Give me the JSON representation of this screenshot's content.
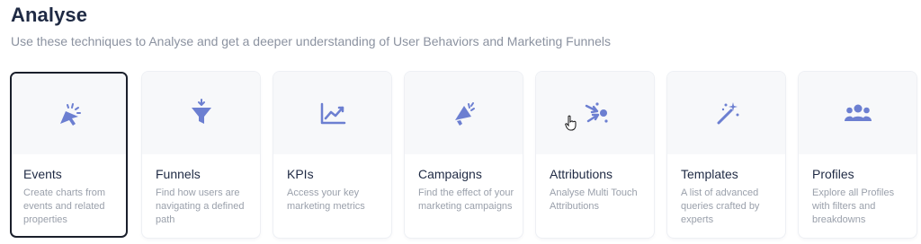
{
  "page": {
    "title": "Analyse",
    "subtitle": "Use these techniques to Analyse and get a deeper understanding of User Behaviors and Marketing Funnels"
  },
  "colors": {
    "icon": "#6c7fd1",
    "title": "#1f2a44",
    "muted": "#9aa0ab",
    "selected_border": "#1a1f2b"
  },
  "cards": [
    {
      "name": "Events",
      "description": "Create charts from events and related properties",
      "icon": "cursor-click-icon",
      "selected": true
    },
    {
      "name": "Funnels",
      "description": "Find how users are navigating a defined path",
      "icon": "funnel-icon",
      "selected": false
    },
    {
      "name": "KPIs",
      "description": "Access your key marketing metrics",
      "icon": "line-chart-icon",
      "selected": false
    },
    {
      "name": "Campaigns",
      "description": "Find the effect of your marketing campaigns",
      "icon": "megaphone-icon",
      "selected": false
    },
    {
      "name": "Attributions",
      "description": "Analyse Multi Touch Attributions",
      "icon": "attribution-arrows-icon",
      "selected": false
    },
    {
      "name": "Templates",
      "description": "A list of advanced queries crafted by experts",
      "icon": "magic-wand-icon",
      "selected": false
    },
    {
      "name": "Profiles",
      "description": "Explore all Profiles with filters and breakdowns",
      "icon": "users-icon",
      "selected": false
    }
  ]
}
